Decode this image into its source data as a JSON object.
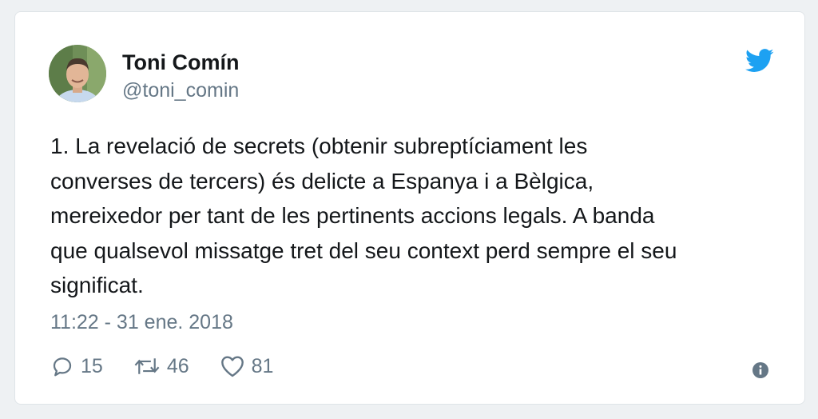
{
  "author": {
    "name": "Toni Comín",
    "handle": "@toni_comin"
  },
  "tweet": {
    "text": "1. La revelació de secrets (obtenir subreptíciament les\nconverses de tercers) és delicte a Espanya i a Bèlgica,\nmereixedor per tant de les pertinents accions legals. A banda\nque qualsevol missatge tret del seu context perd sempre el seu\nsignificat.",
    "timestamp": "11:22 - 31 ene. 2018"
  },
  "actions": {
    "replies": "15",
    "retweets": "46",
    "likes": "81"
  },
  "icons": {
    "brand": "twitter-bird-icon",
    "reply": "reply-bubble-icon",
    "retweet": "retweet-icon",
    "like": "heart-icon",
    "info": "info-icon"
  },
  "colors": {
    "brand_blue": "#1da1f2",
    "text": "#14171a",
    "secondary": "#657786"
  }
}
